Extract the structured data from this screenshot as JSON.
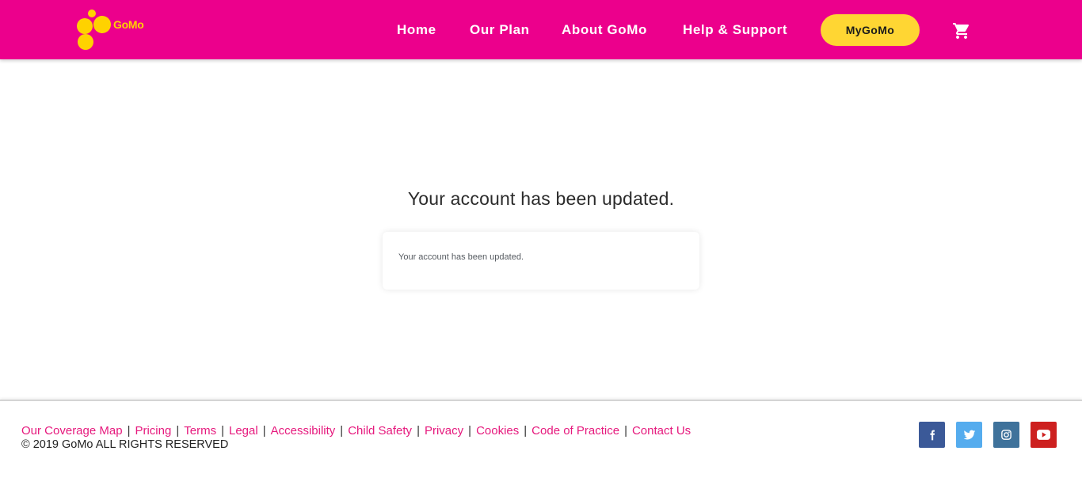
{
  "brand": {
    "logo_text": "GoMo",
    "primary_color": "#ec008c",
    "accent_color": "#ffd200"
  },
  "nav": {
    "items": [
      {
        "label": "Home"
      },
      {
        "label": "Our Plan"
      },
      {
        "label": "About GoMo"
      },
      {
        "label": "Help & Support"
      }
    ],
    "account_button": "MyGoMo",
    "cart_icon": "shopping-cart-icon"
  },
  "main": {
    "title": "Your account has been updated.",
    "message": "Your account has been updated."
  },
  "footer": {
    "links": [
      {
        "label": "Our Coverage Map"
      },
      {
        "label": "Pricing"
      },
      {
        "label": "Terms"
      },
      {
        "label": "Legal"
      },
      {
        "label": "Accessibility"
      },
      {
        "label": "Child Safety"
      },
      {
        "label": "Privacy"
      },
      {
        "label": "Cookies"
      },
      {
        "label": "Code of Practice"
      },
      {
        "label": "Contact Us"
      }
    ],
    "separator": "|",
    "copyright": "© 2019 GoMo ALL RIGHTS RESERVED",
    "social": [
      {
        "icon": "facebook-icon",
        "color": "#3b5998"
      },
      {
        "icon": "twitter-icon",
        "color": "#55acee"
      },
      {
        "icon": "instagram-icon",
        "color": "#3f729b"
      },
      {
        "icon": "youtube-icon",
        "color": "#cd201f"
      }
    ]
  }
}
